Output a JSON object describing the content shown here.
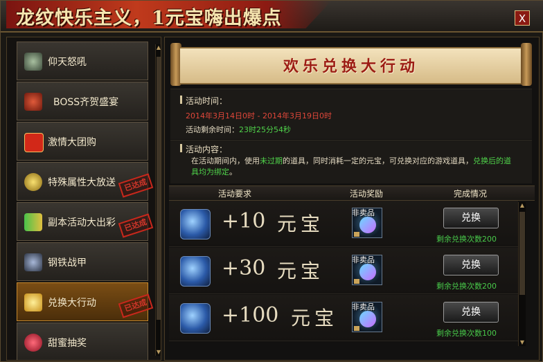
{
  "window": {
    "title": "龙纹快乐主义，1元宝嗨出爆点",
    "close_label": "X"
  },
  "sidebar": {
    "items": [
      {
        "label": "仰天怒吼",
        "icon": "beast-head-icon",
        "done": false,
        "active": false
      },
      {
        "label": "BOSS齐贺盛宴",
        "icon": "red-pouch-icon",
        "done": false,
        "active": false
      },
      {
        "label": "激情大团购",
        "icon": "group-buy-icon",
        "done": false,
        "active": false
      },
      {
        "label": "特殊属性大放送",
        "icon": "orb-icon",
        "done": true,
        "active": false
      },
      {
        "label": "副本活动大出彩",
        "icon": "chart-icon",
        "done": true,
        "active": false
      },
      {
        "label": "钢铁战甲",
        "icon": "armor-icon",
        "done": false,
        "active": false
      },
      {
        "label": "兑换大行动",
        "icon": "gold-ingot-icon",
        "done": true,
        "active": true
      },
      {
        "label": "甜蜜抽奖",
        "icon": "heart-icon",
        "done": false,
        "active": false
      }
    ],
    "done_stamp": "已达成"
  },
  "main": {
    "banner_title": "欢乐兑换大行动",
    "time_section": {
      "label": "活动时间：",
      "range": "2014年3月14日0时 - 2014年3月19日0时",
      "remaining_label": "活动剩余时间：",
      "remaining_value": "23时25分54秒"
    },
    "content_section": {
      "label": "活动内容：",
      "text_1": "在活动期间内，使用",
      "highlight_1": "未过期",
      "text_2": "的道具，同时消耗一定的元宝，可兑换对应的游戏道具，",
      "highlight_2": "兑换后的道具均为绑定",
      "text_3": "。"
    },
    "table": {
      "headers": [
        "活动要求",
        "活动奖励",
        "完成情况"
      ],
      "rows": [
        {
          "amount": "+10",
          "unit": "元宝",
          "reward_tag": "非卖品",
          "button": "兑换",
          "remaining": "剩余兑换次数200"
        },
        {
          "amount": "+30",
          "unit": "元宝",
          "reward_tag": "非卖品",
          "button": "兑换",
          "remaining": "剩余兑换次数200"
        },
        {
          "amount": "+100",
          "unit": "元宝",
          "reward_tag": "非卖品",
          "button": "兑换",
          "remaining": "剩余兑换次数100"
        }
      ]
    }
  },
  "colors": {
    "accent_red": "#e0473a",
    "accent_green": "#4fd24a",
    "banner_text": "#9c1c14"
  }
}
